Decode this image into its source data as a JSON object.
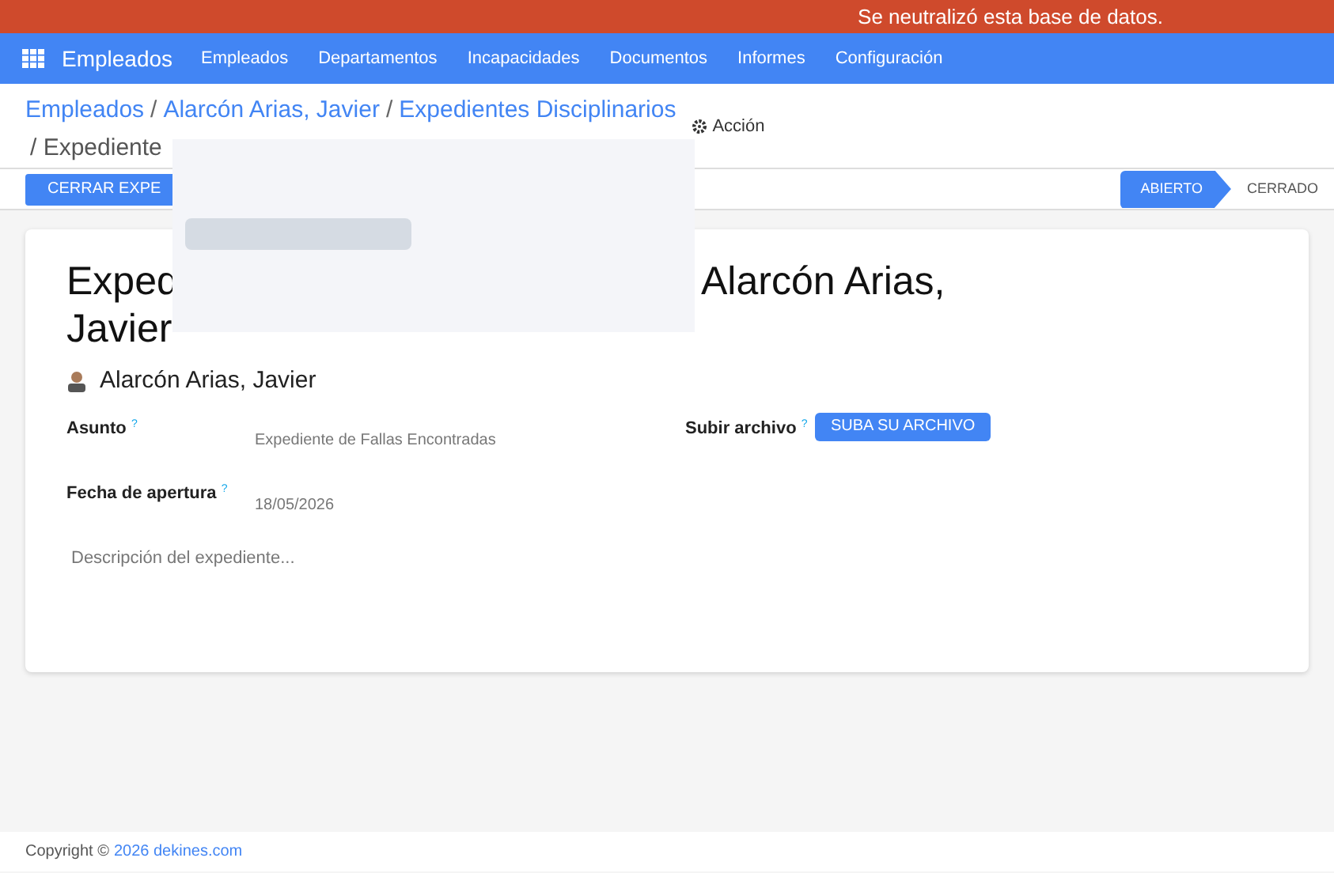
{
  "banner": {
    "text": "Se neutralizó esta base de datos."
  },
  "navbar": {
    "app": "Empleados",
    "menu": [
      "Empleados",
      "Departamentos",
      "Incapacidades",
      "Documentos",
      "Informes",
      "Configuración"
    ]
  },
  "breadcrumb": {
    "links": [
      "Empleados",
      "Alarcón Arias, Javier",
      "Expedientes Disciplinarios"
    ],
    "separators": [
      "/",
      "/"
    ],
    "current": "/ Expediente"
  },
  "action_menu": {
    "label": "Acción"
  },
  "statusbar": {
    "button": "CERRAR EXPE",
    "stages": [
      {
        "label": "ABIERTO",
        "selected": true
      },
      {
        "label": "CERRADO",
        "selected": false
      }
    ]
  },
  "form": {
    "title_parts": [
      "Exped",
      "Alarcón Arias,",
      "Javier"
    ],
    "employee": "Alarcón Arias, Javier",
    "fields": [
      {
        "label": "Asunto",
        "help": "?",
        "value": "Expediente de Fallas Encontradas"
      },
      {
        "label": "Fecha de apertura",
        "help": "?",
        "value": "18/05/2026"
      }
    ],
    "upload": {
      "label": "Subir archivo",
      "help": "?",
      "button": "SUBA SU ARCHIVO"
    },
    "description": {
      "placeholder": "Descripción del expediente..."
    }
  },
  "footer": {
    "text": "Copyright ©",
    "link": "2026 dekines.com"
  }
}
